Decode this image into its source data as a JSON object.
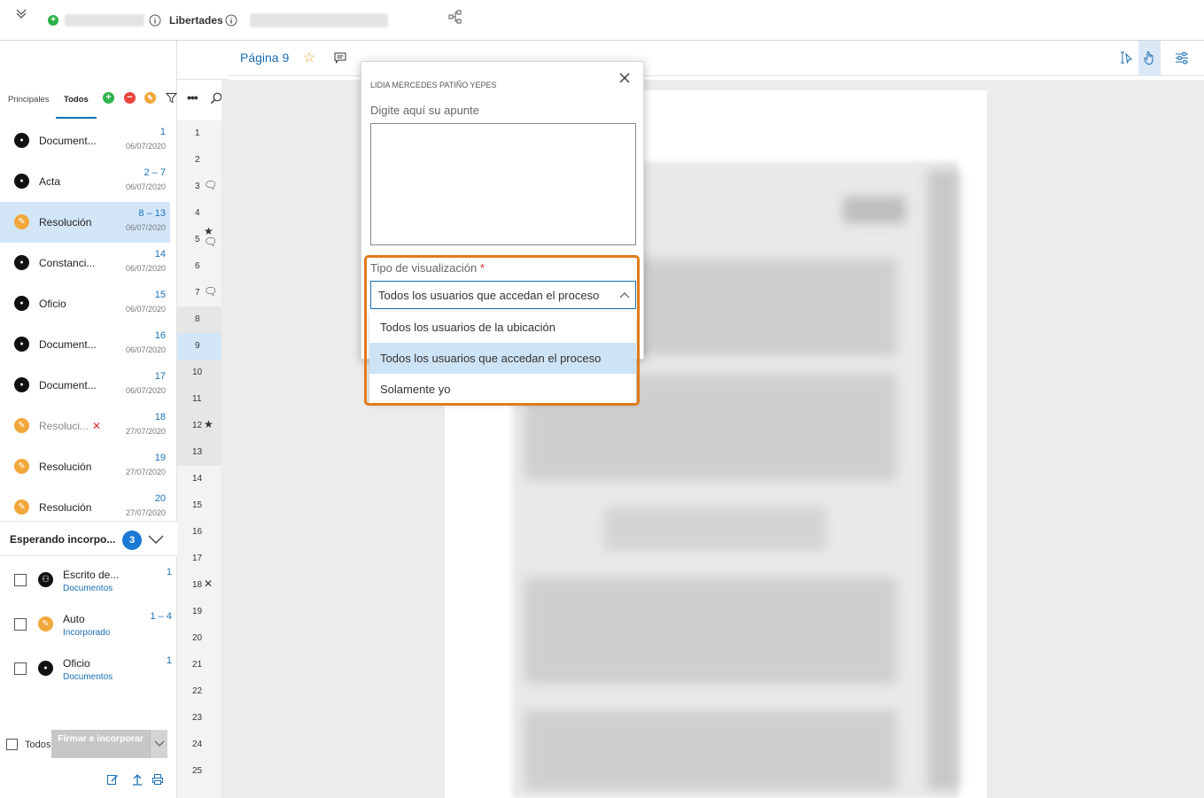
{
  "topbar": {
    "title": "Libertades"
  },
  "tabs": {
    "principales": "Principales",
    "todos": "Todos"
  },
  "documents": [
    {
      "name": "Document...",
      "pages": "1",
      "date": "06/07/2020",
      "kind": "doc"
    },
    {
      "name": "Acta",
      "pages": "2 – 7",
      "date": "06/07/2020",
      "kind": "doc"
    },
    {
      "name": "Resolución",
      "pages": "8 – 13",
      "date": "06/07/2020",
      "kind": "res",
      "selected": true
    },
    {
      "name": "Constanci...",
      "pages": "14",
      "date": "06/07/2020",
      "kind": "doc"
    },
    {
      "name": "Oficio",
      "pages": "15",
      "date": "06/07/2020",
      "kind": "doc"
    },
    {
      "name": "Document...",
      "pages": "16",
      "date": "06/07/2020",
      "kind": "doc"
    },
    {
      "name": "Document...",
      "pages": "17",
      "date": "06/07/2020",
      "kind": "doc"
    },
    {
      "name": "Resoluci...",
      "pages": "18",
      "date": "27/07/2020",
      "kind": "res",
      "deleted": true
    },
    {
      "name": "Resolución",
      "pages": "19",
      "date": "27/07/2020",
      "kind": "res"
    },
    {
      "name": "Resolución",
      "pages": "20",
      "date": "27/07/2020",
      "kind": "res"
    }
  ],
  "page_numbers": [
    {
      "n": "1",
      "mark": ""
    },
    {
      "n": "2",
      "mark": ""
    },
    {
      "n": "3",
      "mark": "comment"
    },
    {
      "n": "4",
      "mark": ""
    },
    {
      "n": "5",
      "mark": "star-comment"
    },
    {
      "n": "6",
      "mark": ""
    },
    {
      "n": "7",
      "mark": "comment"
    },
    {
      "n": "8",
      "mark": ""
    },
    {
      "n": "9",
      "mark": "",
      "current": true
    },
    {
      "n": "10",
      "mark": ""
    },
    {
      "n": "11",
      "mark": ""
    },
    {
      "n": "12",
      "mark": "star"
    },
    {
      "n": "13",
      "mark": ""
    },
    {
      "n": "14",
      "mark": ""
    },
    {
      "n": "15",
      "mark": ""
    },
    {
      "n": "16",
      "mark": ""
    },
    {
      "n": "17",
      "mark": ""
    },
    {
      "n": "18",
      "mark": "x"
    },
    {
      "n": "19",
      "mark": ""
    },
    {
      "n": "20",
      "mark": ""
    },
    {
      "n": "21",
      "mark": ""
    },
    {
      "n": "22",
      "mark": ""
    },
    {
      "n": "23",
      "mark": ""
    },
    {
      "n": "24",
      "mark": ""
    },
    {
      "n": "25",
      "mark": ""
    }
  ],
  "waiting": {
    "title": "Esperando incorpo...",
    "count": "3",
    "items": [
      {
        "name": "Escrito de...",
        "sub": "Documentos",
        "pages": "1",
        "kind": "escrito"
      },
      {
        "name": "Auto",
        "sub": "Incorporado",
        "pages": "1 – 4",
        "kind": "res"
      },
      {
        "name": "Oficio",
        "sub": "Documentos",
        "pages": "1",
        "kind": "doc"
      }
    ]
  },
  "footer": {
    "todos_label": "Todos",
    "sign_button": "Firmar e incorporar"
  },
  "viewer": {
    "page_label": "Página 9"
  },
  "dialog": {
    "author": "LIDIA MERCEDES PATIÑO YEPES",
    "note_label": "Digite aquí su apunte",
    "note_value": "",
    "type_label": "Tipo de visualización",
    "required_mark": "*",
    "selected_value": "Todos los usuarios que accedan el proceso",
    "options": [
      "Todos los usuarios de la ubicación",
      "Todos los usuarios que accedan el proceso",
      "Solamente yo"
    ],
    "selected_index": 1
  },
  "colors": {
    "accent": "#1a6fb5",
    "orange_highlight": "#e07b1a",
    "selected_row": "#d3e6f8",
    "green": "#2db34a",
    "red": "#e8453c",
    "amber": "#f2a73b"
  }
}
